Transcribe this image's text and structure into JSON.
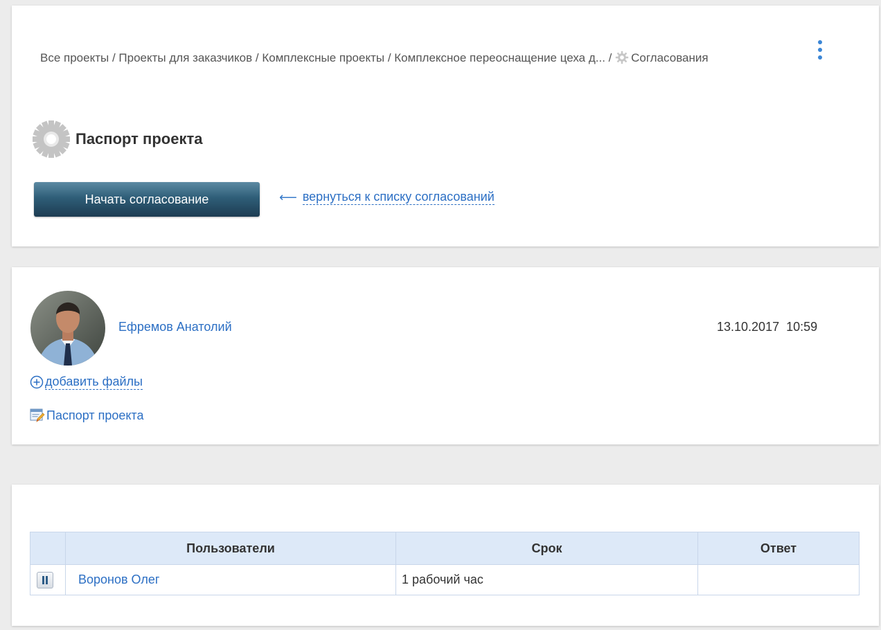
{
  "breadcrumb": {
    "items": [
      "Все проекты",
      "Проекты для заказчиков",
      "Комплексные проекты",
      "Комплексное переоснащение цеха д...",
      "Согласования"
    ],
    "separator": "/"
  },
  "header": {
    "title": "Паспорт проекта",
    "start_button": "Начать согласование",
    "back_link": "вернуться к списку согласований"
  },
  "author": {
    "name": "Ефремов Анатолий",
    "date": "13.10.2017",
    "time": "10:59",
    "add_files": "добавить файлы",
    "document": "Паспорт проекта"
  },
  "table": {
    "columns": [
      "Пользователи",
      "Срок",
      "Ответ"
    ],
    "rows": [
      {
        "user": "Воронов Олег",
        "deadline": "1 рабочий час",
        "answer": ""
      }
    ]
  },
  "colors": {
    "link": "#2c6fc4",
    "button": "#2f5e78",
    "table_header": "#dde9f8",
    "background": "#ececec"
  }
}
